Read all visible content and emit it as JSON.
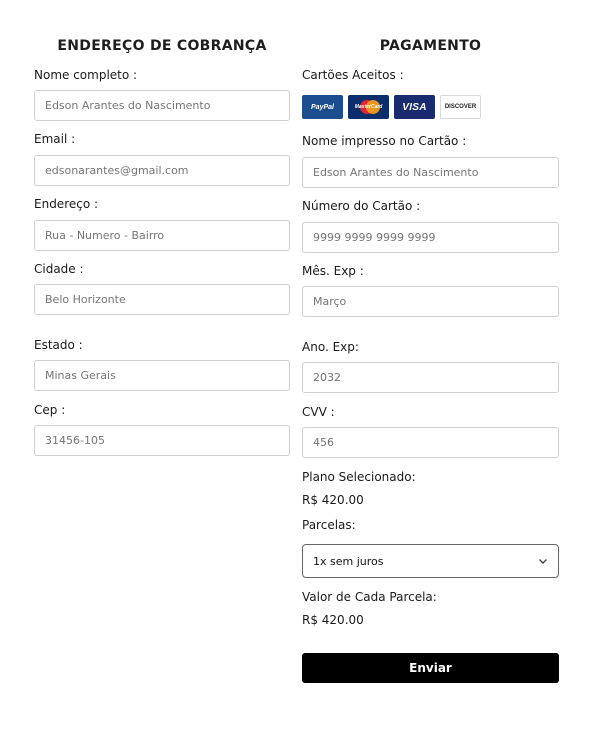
{
  "billing": {
    "title": "ENDEREÇO DE COBRANÇA",
    "fields": {
      "name": {
        "label": "Nome completo :",
        "placeholder": "Edson Arantes do Nascimento"
      },
      "email": {
        "label": "Email :",
        "placeholder": "edsonarantes@gmail.com"
      },
      "address": {
        "label": "Endereço :",
        "placeholder": "Rua - Numero - Bairro"
      },
      "city": {
        "label": "Cidade :",
        "placeholder": "Belo Horizonte"
      },
      "state": {
        "label": "Estado :",
        "placeholder": "Minas Gerais"
      },
      "zip": {
        "label": "Cep :",
        "placeholder": "31456-105"
      }
    }
  },
  "payment": {
    "title": "PAGAMENTO",
    "accepted_label": "Cartões Aceitos :",
    "cards": {
      "paypal": "PayPal",
      "mastercard": "MasterCard",
      "visa": "VISA",
      "discover": "DISCOVER"
    },
    "fields": {
      "card_name": {
        "label": "Nome impresso no Cartão :",
        "placeholder": "Edson Arantes do Nascimento"
      },
      "card_number": {
        "label": "Número do Cartão :",
        "placeholder": "9999 9999 9999 9999"
      },
      "exp_month": {
        "label": "Mês. Exp :",
        "placeholder": "Março"
      },
      "exp_year": {
        "label": "Ano. Exp:",
        "placeholder": "2032"
      },
      "cvv": {
        "label": "CVV :",
        "placeholder": "456"
      }
    },
    "plan_label": "Plano Selecionado:",
    "plan_value": "R$ 420.00",
    "installments_label": "Parcelas:",
    "installments_selected": "1x sem juros",
    "installment_value_label": "Valor de Cada Parcela:",
    "installment_value": "R$ 420.00",
    "submit_label": "Enviar"
  }
}
